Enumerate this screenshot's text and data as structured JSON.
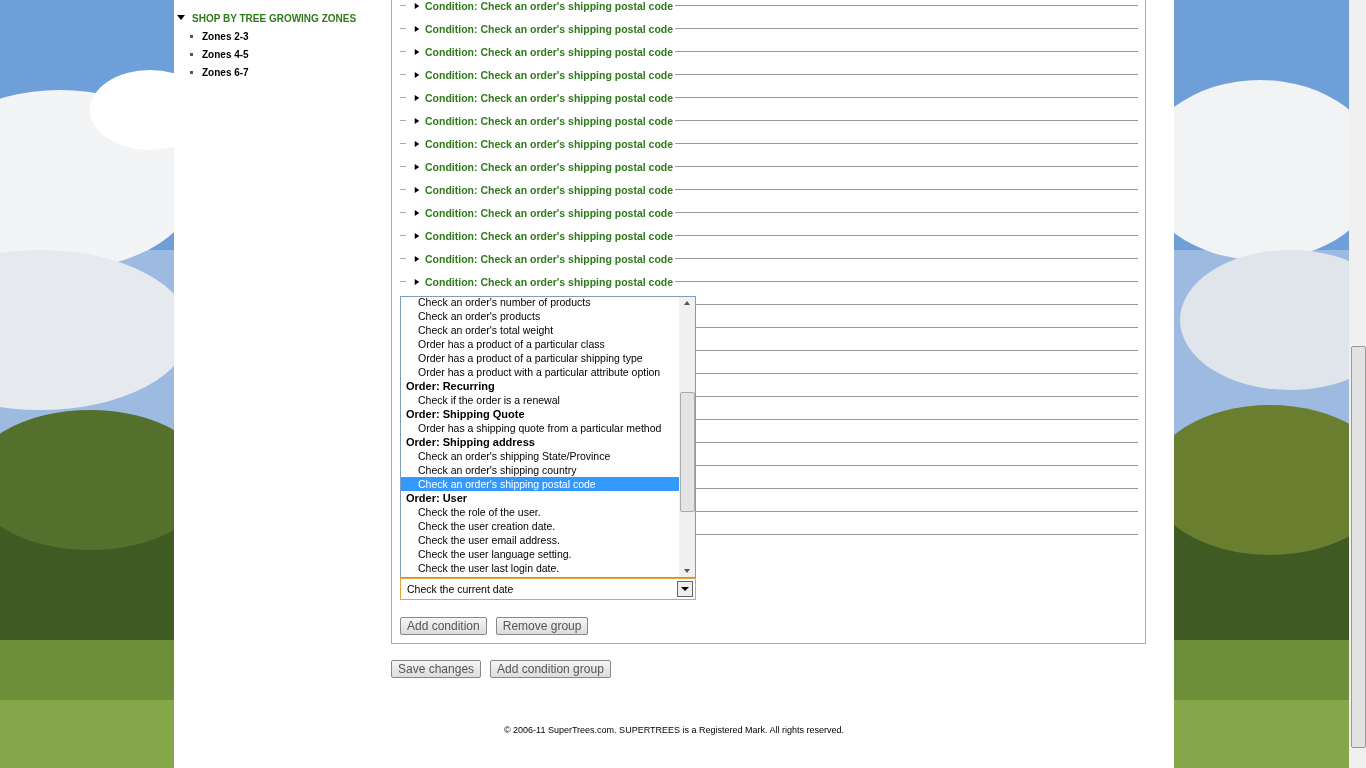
{
  "sidebar": {
    "section": {
      "label": "SHOP BY TREE GROWING ZONES",
      "expanded": true,
      "items": [
        "Zones 2-3",
        "Zones 4-5",
        "Zones 6-7"
      ]
    }
  },
  "conditions": [
    {
      "label": "Condition: Check an order's shipping postal code",
      "expanded": false
    },
    {
      "label": "Condition: Check an order's shipping postal code",
      "expanded": false
    },
    {
      "label": "Condition: Check an order's shipping postal code",
      "expanded": false
    },
    {
      "label": "Condition: Check an order's shipping postal code",
      "expanded": false
    },
    {
      "label": "Condition: Check an order's shipping postal code",
      "expanded": false
    },
    {
      "label": "Condition: Check an order's shipping postal code",
      "expanded": false
    },
    {
      "label": "Condition: Check an order's shipping postal code",
      "expanded": false
    },
    {
      "label": "Condition: Check an order's shipping postal code",
      "expanded": false
    },
    {
      "label": "Condition: Check an order's shipping postal code",
      "expanded": false
    },
    {
      "label": "Condition: Check an order's shipping postal code",
      "expanded": false
    },
    {
      "label": "Condition: Check an order's shipping postal code",
      "expanded": false
    },
    {
      "label": "Condition: Check an order's shipping postal code",
      "expanded": false
    },
    {
      "label": "Condition: Check an order's shipping postal code",
      "expanded": false
    }
  ],
  "condition_select": {
    "value": "Check the current date",
    "options": [
      {
        "kind": "option",
        "label": "Check an order's number of products",
        "selected": false
      },
      {
        "kind": "option",
        "label": "Check an order's products",
        "selected": false
      },
      {
        "kind": "option",
        "label": "Check an order's total weight",
        "selected": false
      },
      {
        "kind": "option",
        "label": "Order has a product of a particular class",
        "selected": false
      },
      {
        "kind": "option",
        "label": "Order has a product of a particular shipping type",
        "selected": false
      },
      {
        "kind": "option",
        "label": "Order has a product with a particular attribute option",
        "selected": false
      },
      {
        "kind": "group",
        "label": "Order: Recurring"
      },
      {
        "kind": "option",
        "label": "Check if the order is a renewal",
        "selected": false
      },
      {
        "kind": "group",
        "label": "Order: Shipping Quote"
      },
      {
        "kind": "option",
        "label": "Order has a shipping quote from a particular method",
        "selected": false
      },
      {
        "kind": "group",
        "label": "Order: Shipping address"
      },
      {
        "kind": "option",
        "label": "Check an order's shipping State/Province",
        "selected": false
      },
      {
        "kind": "option",
        "label": "Check an order's shipping country",
        "selected": false
      },
      {
        "kind": "option",
        "label": "Check an order's shipping postal code",
        "selected": true
      },
      {
        "kind": "group",
        "label": "Order: User"
      },
      {
        "kind": "option",
        "label": "Check the role of the user.",
        "selected": false
      },
      {
        "kind": "option",
        "label": "Check the user creation date.",
        "selected": false
      },
      {
        "kind": "option",
        "label": "Check the user email address.",
        "selected": false
      },
      {
        "kind": "option",
        "label": "Check the user language setting.",
        "selected": false
      },
      {
        "kind": "option",
        "label": "Check the user last login date.",
        "selected": false
      }
    ]
  },
  "group_buttons": [
    "Add condition",
    "Remove group"
  ],
  "form_buttons": [
    "Save changes",
    "Add condition group"
  ],
  "footer": "© 2006-11 SuperTrees.com. SUPERTREES is a Registered Mark. All rights reserved."
}
